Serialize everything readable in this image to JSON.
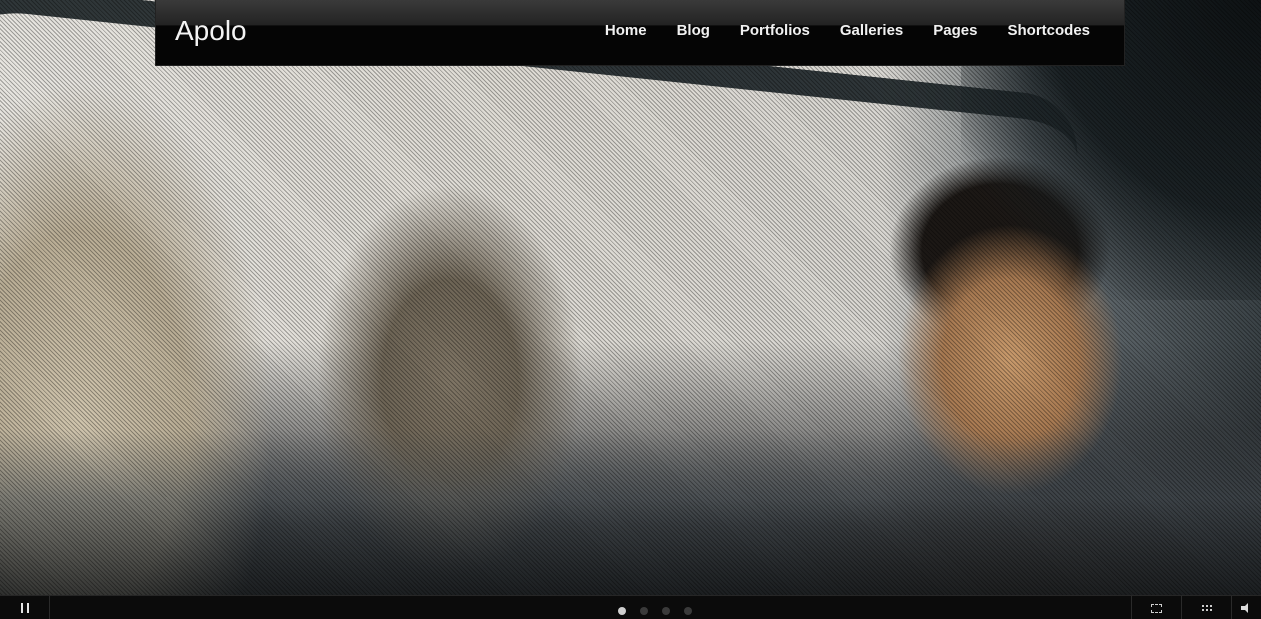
{
  "site": {
    "logo": "Apolo"
  },
  "nav": {
    "items": [
      {
        "label": "Home"
      },
      {
        "label": "Blog"
      },
      {
        "label": "Portfolios"
      },
      {
        "label": "Galleries"
      },
      {
        "label": "Pages"
      },
      {
        "label": "Shortcodes"
      }
    ]
  },
  "slider": {
    "slide_count": 4,
    "active_slide": 1
  },
  "icons": {
    "pause": "pause-icon",
    "fullscreen": "fullscreen-icon",
    "thumbnails": "grid-icon",
    "volume": "volume-icon"
  },
  "colors": {
    "header_bg": "#050505",
    "nav_text": "#f1f1f1",
    "control_bar": "#0b0b0b"
  }
}
